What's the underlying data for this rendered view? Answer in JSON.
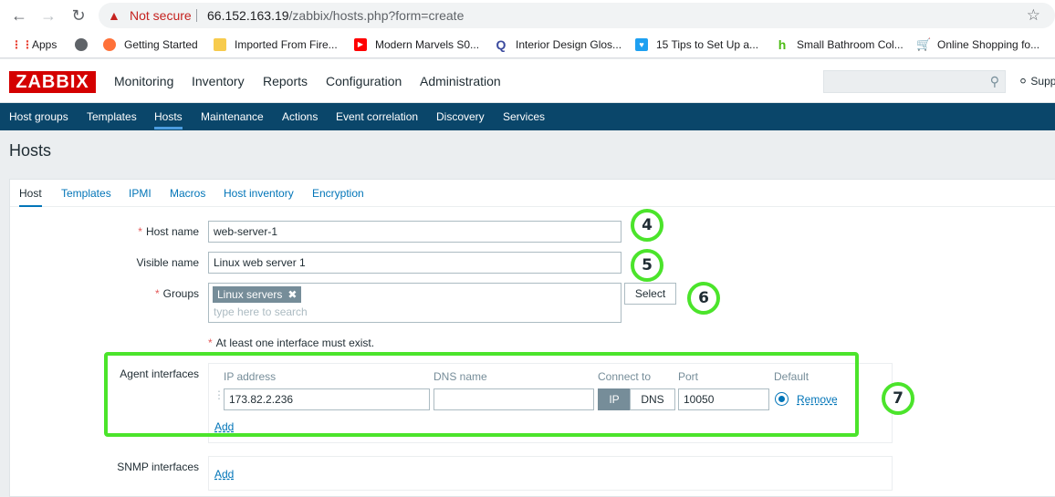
{
  "browser": {
    "security_label": "Not secure",
    "url_host": "66.152.163.19",
    "url_path": "/zabbix/hosts.php?form=create",
    "bookmarks": [
      {
        "label": "Apps",
        "icon": "apps-grid-icon"
      },
      {
        "label": "",
        "icon": "globe-icon"
      },
      {
        "label": "Getting Started",
        "icon": "firefox-icon"
      },
      {
        "label": "Imported From Fire...",
        "icon": "folder-icon"
      },
      {
        "label": "Modern Marvels S0...",
        "icon": "youtube-icon"
      },
      {
        "label": "Interior Design Glos...",
        "icon": "q-icon"
      },
      {
        "label": "15 Tips to Set Up a...",
        "icon": "heart-icon"
      },
      {
        "label": "Small Bathroom Col...",
        "icon": "houzz-icon"
      },
      {
        "label": "Online Shopping fo...",
        "icon": "cart-icon"
      }
    ]
  },
  "header": {
    "logo": "ZABBIX",
    "menu": [
      "Monitoring",
      "Inventory",
      "Reports",
      "Configuration",
      "Administration"
    ],
    "support": "Supp"
  },
  "submenu": [
    "Host groups",
    "Templates",
    "Hosts",
    "Maintenance",
    "Actions",
    "Event correlation",
    "Discovery",
    "Services"
  ],
  "page": {
    "title": "Hosts",
    "tabs": [
      "Host",
      "Templates",
      "IPMI",
      "Macros",
      "Host inventory",
      "Encryption"
    ]
  },
  "form": {
    "host_name_label": "Host name",
    "host_name_value": "web-server-1",
    "visible_name_label": "Visible name",
    "visible_name_value": "Linux web server 1",
    "groups_label": "Groups",
    "group_chip": "Linux servers",
    "groups_placeholder": "type here to search",
    "select_button": "Select",
    "required_star": "*",
    "interface_warning": "At least one interface must exist.",
    "agent_label": "Agent interfaces",
    "agent_columns": {
      "ip": "IP address",
      "dns": "DNS name",
      "connect": "Connect to",
      "port": "Port",
      "default": "Default"
    },
    "agent_ip": "173.82.2.236",
    "agent_dns": "",
    "connect_ip": "IP",
    "connect_dns": "DNS",
    "agent_port": "10050",
    "remove_link": "Remove",
    "add_link": "Add",
    "snmp_label": "SNMP interfaces",
    "snmp_add_link": "Add"
  },
  "annotations": {
    "badges": [
      "4",
      "5",
      "6",
      "7"
    ],
    "color": "#4be42b"
  }
}
